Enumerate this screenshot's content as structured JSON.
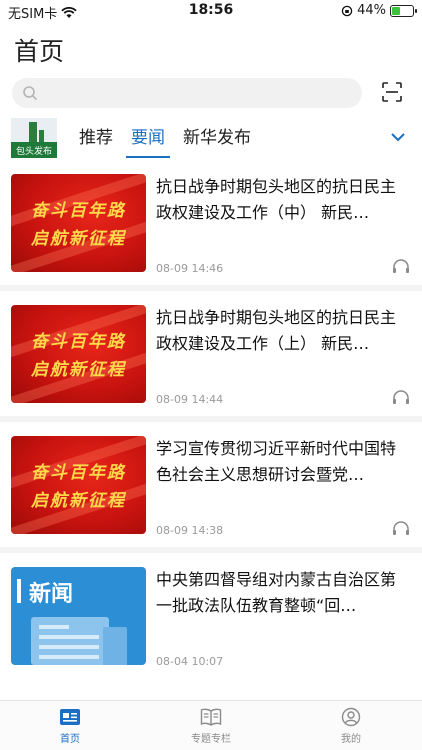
{
  "status_bar": {
    "carrier": "无SIM卡",
    "time": "18:56",
    "battery": "44%",
    "battery_level": 0.44
  },
  "page_title": "首页",
  "search": {
    "placeholder": ""
  },
  "channel_logo_text": "包头发布",
  "tabs": [
    {
      "label": "推荐",
      "active": false
    },
    {
      "label": "要闻",
      "active": true
    },
    {
      "label": "新华发布",
      "active": false
    }
  ],
  "news": [
    {
      "thumb_type": "red",
      "thumb_line1": "奋斗百年路",
      "thumb_line2": "启航新征程",
      "title": "抗日战争时期包头地区的抗日民主政权建设及工作（中） 新民…",
      "time": "08-09 14:46",
      "has_audio": true
    },
    {
      "thumb_type": "red",
      "thumb_line1": "奋斗百年路",
      "thumb_line2": "启航新征程",
      "title": "抗日战争时期包头地区的抗日民主政权建设及工作（上） 新民…",
      "time": "08-09 14:44",
      "has_audio": true
    },
    {
      "thumb_type": "red",
      "thumb_line1": "奋斗百年路",
      "thumb_line2": "启航新征程",
      "title": "学习宣传贯彻习近平新时代中国特色社会主义思想研讨会暨党…",
      "time": "08-09 14:38",
      "has_audio": true
    },
    {
      "thumb_type": "blue",
      "thumb_word": "新闻",
      "title": "中央第四督导组对内蒙古自治区第一批政法队伍教育整顿“回…",
      "time": "08-04 10:07",
      "has_audio": false
    }
  ],
  "tab_bar": {
    "items": [
      {
        "label": "首页",
        "icon": "news-home-icon",
        "active": true
      },
      {
        "label": "专题专栏",
        "icon": "book-icon",
        "active": false
      },
      {
        "label": "我的",
        "icon": "user-icon",
        "active": false
      }
    ]
  },
  "colors": {
    "accent": "#1b6fc2",
    "thumb_red": "#c8130f",
    "thumb_gold": "#ffd94a",
    "thumb_blue": "#2c8fd6",
    "battery_green": "#3ec23e"
  }
}
